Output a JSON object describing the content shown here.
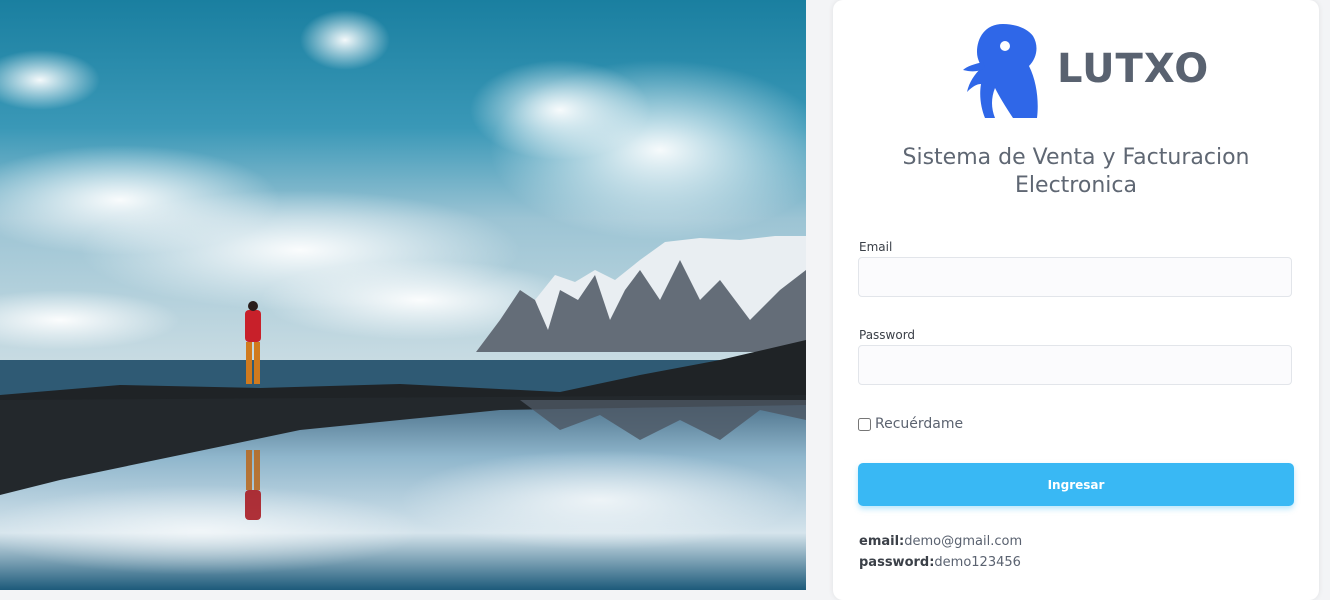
{
  "brand": {
    "name": "LUTXO",
    "logo_icon": "penguin-logo-icon",
    "color": "#2f67e8"
  },
  "subtitle": {
    "line1": "Sistema de Venta y Facturacion",
    "line2": "Electronica"
  },
  "form": {
    "email_label": "Email",
    "email_value": "",
    "password_label": "Password",
    "password_value": "",
    "remember_label": "Recuérdame",
    "remember_checked": false,
    "submit_label": "Ingresar"
  },
  "demo": {
    "email_key": "email:",
    "email_value": "demo@gmail.com",
    "password_key": "password:",
    "password_value": "demo123456"
  },
  "colors": {
    "accent": "#39b8f4",
    "text": "#5f6773"
  }
}
